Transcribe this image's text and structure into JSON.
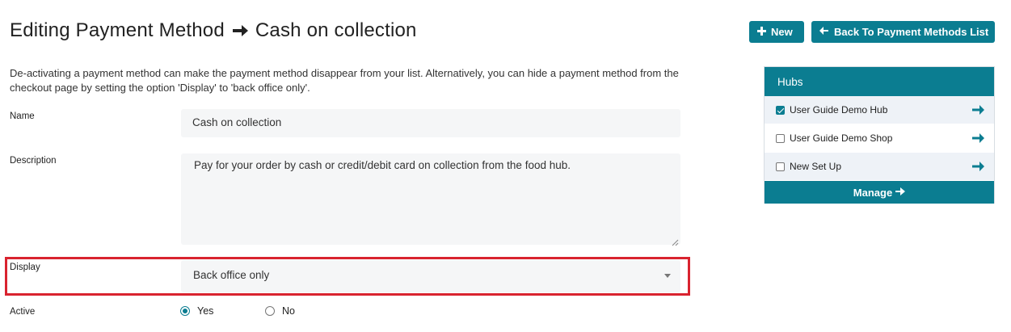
{
  "header": {
    "title_prefix": "Editing Payment Method",
    "title_name": "Cash on collection",
    "new_label": "New",
    "back_label": "Back To Payment Methods List"
  },
  "intro_text": "De-activating a payment method can make the payment method disappear from your list. Alternatively, you can hide a payment method from the checkout page by setting the option 'Display' to 'back office only'.",
  "form": {
    "name_label": "Name",
    "name_value": "Cash on collection",
    "description_label": "Description",
    "description_value": "Pay for your order by cash or credit/debit card on collection from the food hub.",
    "display_label": "Display",
    "display_value": "Back office only",
    "active_label": "Active",
    "active_yes": "Yes",
    "active_no": "No",
    "active_selected": "Yes"
  },
  "hubs": {
    "title": "Hubs",
    "items": [
      {
        "label": "User Guide Demo Hub",
        "checked": true
      },
      {
        "label": "User Guide Demo Shop",
        "checked": false
      },
      {
        "label": "New Set Up",
        "checked": false
      }
    ],
    "manage_label": "Manage"
  },
  "colors": {
    "accent": "#0b7d91",
    "highlight": "#d9232f",
    "field_bg": "#f5f6f7"
  }
}
